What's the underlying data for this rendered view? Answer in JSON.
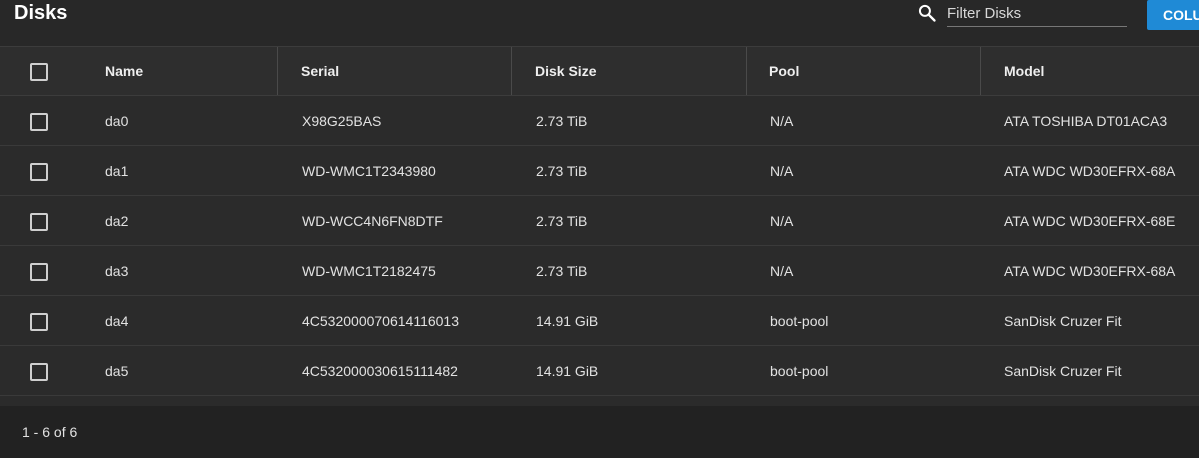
{
  "header": {
    "title": "Disks",
    "search_placeholder": "Filter Disks",
    "columns_label": "COLUMNS"
  },
  "table": {
    "columns": [
      "Name",
      "Serial",
      "Disk Size",
      "Pool",
      "Model"
    ],
    "rows": [
      [
        "da0",
        "X98G25BAS",
        "2.73 TiB",
        "N/A",
        "ATA TOSHIBA DT01ACA3"
      ],
      [
        "da1",
        "WD-WMC1T2343980",
        "2.73 TiB",
        "N/A",
        "ATA WDC WD30EFRX-68A"
      ],
      [
        "da2",
        "WD-WCC4N6FN8DTF",
        "2.73 TiB",
        "N/A",
        "ATA WDC WD30EFRX-68E"
      ],
      [
        "da3",
        "WD-WMC1T2182475",
        "2.73 TiB",
        "N/A",
        "ATA WDC WD30EFRX-68A"
      ],
      [
        "da4",
        "4C532000070614116013",
        "14.91 GiB",
        "boot-pool",
        "SanDisk Cruzer Fit"
      ],
      [
        "da5",
        "4C532000030615111482",
        "14.91 GiB",
        "boot-pool",
        "SanDisk Cruzer Fit"
      ]
    ]
  },
  "footer": {
    "range": "1 - 6 of 6"
  },
  "icons": {
    "search": "search-icon",
    "checkbox": "checkbox-icon"
  },
  "colors": {
    "accent": "#1f8ad6",
    "background": "#282828"
  }
}
